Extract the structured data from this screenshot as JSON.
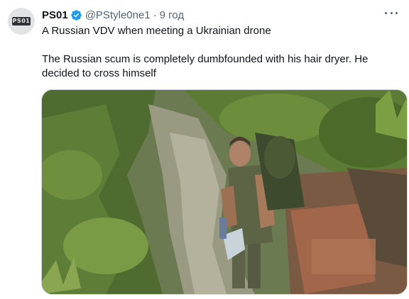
{
  "tweet": {
    "avatar_text": "PS01",
    "display_name": "PS01",
    "handle": "@PStyle0ne1",
    "separator": "·",
    "time": "9 год",
    "text_line1": "A Russian VDV when meeting a Ukrainian drone",
    "text_line2": "The Russian scum is completely dumbfounded with his hair dryer. He decided to cross himself"
  },
  "icons": {
    "verified": "verified-badge-icon",
    "more": "more-options-icon"
  },
  "colors": {
    "verified": "#1d9bf0",
    "secondary_text": "#536471",
    "primary_text": "#0f1419"
  }
}
